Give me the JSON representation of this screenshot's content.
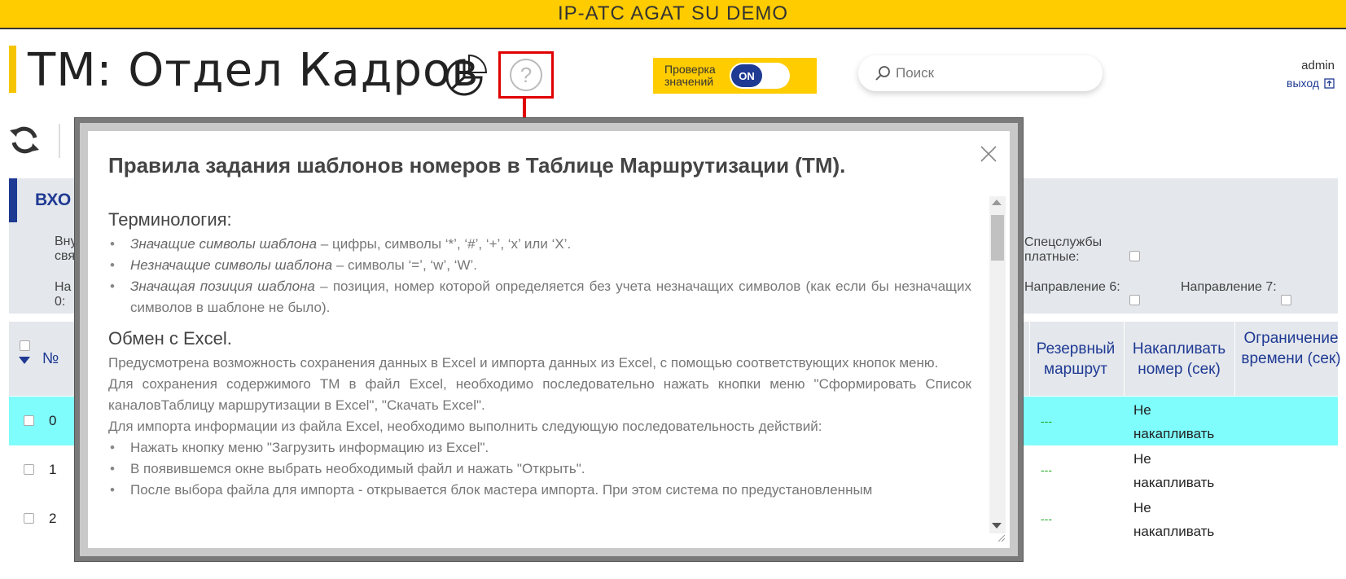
{
  "topbar": {
    "title": "IP-ATC AGAT SU DEMO"
  },
  "header": {
    "page_title": "ТМ: Отдел Кадров",
    "help_symbol": "?",
    "check_label": "Проверка значений",
    "toggle_label": "ON",
    "search_placeholder": "Поиск",
    "user": "admin",
    "logout": "выход"
  },
  "panel": {
    "title_fragment": "ВХО",
    "frag1_line1": "Вну",
    "frag1_line2": "свя",
    "frag2_line1": "На",
    "frag2_line2": "0:",
    "special_label": "Спецслужбы платные:",
    "dir6_label": "Направление 6:",
    "dir7_label": "Направление 7:"
  },
  "table": {
    "headers": {
      "num": "№",
      "backup_route": "Резервный маршрут",
      "accumulate": "Накапливать номер (сек)",
      "time_limit": "Ограничение времени (сек)"
    },
    "rows": [
      {
        "num": "0",
        "backup": "---",
        "accumulate": "Не накапливать"
      },
      {
        "num": "1",
        "backup": "---",
        "accumulate": "Не накапливать"
      },
      {
        "num": "2",
        "backup": "---",
        "accumulate": "Не накапливать"
      }
    ]
  },
  "modal": {
    "title": "Правила задания шаблонов номеров в Таблице Маршрутизации (ТМ).",
    "sections": {
      "terminology": {
        "heading": "Терминология:",
        "items": [
          {
            "term": "Значащие символы шаблона",
            "text": " – цифры, символы ‘*’, ‘#’, ‘+’, ‘x’ или ‘X’."
          },
          {
            "term": "Незначащие символы шаблона",
            "text": " – символы ‘=’, ‘w’, ‘W’."
          },
          {
            "term": "Значащая позиция шаблона",
            "text": " – позиция, номер которой определяется без учета незначащих символов (как если бы незначащих символов в шаблоне не было)."
          }
        ]
      },
      "excel": {
        "heading": "Обмен с Excel.",
        "p1": "Предусмотрена возможность сохранения данных в Excel и импорта данных из Excel, с помощью соответствующих кнопок меню.",
        "p2": "Для сохранения содержимого ТМ в файл Excel, необходимо последовательно нажать кнопки меню \"Сформировать Список каналовТаблицу маршрутизации в Excel\", \"Скачать Excel\".",
        "p3": "Для импорта информации из файла Excel, необходимо выполнить следующую последовательность действий:",
        "steps": [
          "Нажать кнопку меню \"Загрузить информацию из Excel\".",
          "В появившемся окне выбрать необходимый файл и нажать \"Открыть\".",
          "После выбора файла для импорта - открывается блок мастера импорта. При этом система по предустановленным"
        ]
      }
    }
  },
  "colors": {
    "accent_yellow": "#ffcc00",
    "brand_blue": "#1f3a93",
    "highlight_row": "#7ffcfc",
    "annotation_red": "#e00000"
  }
}
